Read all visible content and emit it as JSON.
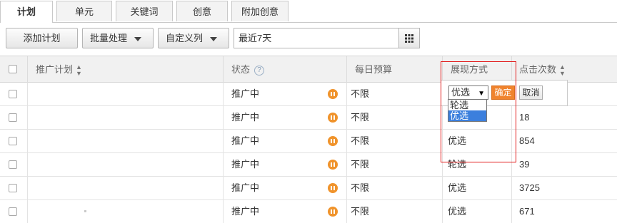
{
  "tabs": [
    {
      "label": "计划",
      "active": true
    },
    {
      "label": "单元"
    },
    {
      "label": "关键词"
    },
    {
      "label": "创意"
    },
    {
      "label": "附加创意"
    }
  ],
  "toolbar": {
    "add_plan": "添加计划",
    "batch": "批量处理",
    "custom_columns": "自定义列",
    "date_range": "最近7天"
  },
  "table": {
    "headers": {
      "plan": "推广计划",
      "status": "状态",
      "budget": "每日预算",
      "display": "展现方式",
      "clicks": "点击次数"
    },
    "rows": [
      {
        "status": "推广中",
        "budget": "不限",
        "display": "",
        "clicks": ""
      },
      {
        "status": "推广中",
        "budget": "不限",
        "display": "",
        "clicks": "18"
      },
      {
        "status": "推广中",
        "budget": "不限",
        "display": "优选",
        "clicks": "854"
      },
      {
        "status": "推广中",
        "budget": "不限",
        "display": "轮选",
        "clicks": "39"
      },
      {
        "status": "推广中",
        "budget": "不限",
        "display": "优选",
        "clicks": "3725"
      },
      {
        "status": "推广中",
        "budget": "不限",
        "display": "优选",
        "clicks": "671"
      }
    ]
  },
  "editor": {
    "selected": "优选",
    "options": [
      "轮选",
      "优选"
    ],
    "confirm": "确定",
    "cancel": "取消"
  },
  "colors": {
    "accent_orange": "#f0832d",
    "highlight_red": "#e21b1b",
    "selection_blue": "#3b7fdd"
  }
}
